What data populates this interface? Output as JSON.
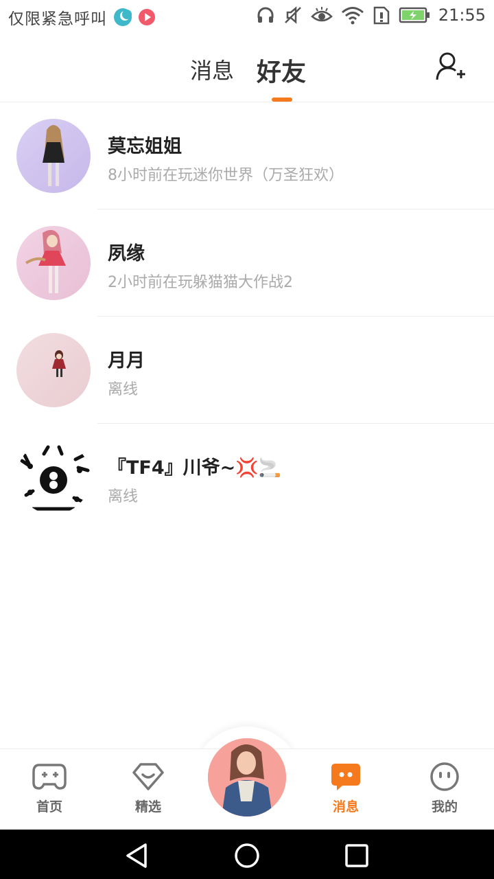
{
  "status_bar": {
    "carrier": "仅限紧急呼叫",
    "time": "21:55",
    "icons": [
      "moon-icon",
      "record-icon",
      "headphones-icon",
      "mute-icon",
      "eye-icon",
      "wifi-icon",
      "sim-icon",
      "battery-icon"
    ]
  },
  "header": {
    "tabs": [
      {
        "label": "消息",
        "active": false
      },
      {
        "label": "好友",
        "active": true
      }
    ],
    "accent_color": "#f57a1e",
    "add_friend_icon": "add-person-icon"
  },
  "friends": [
    {
      "name": "莫忘姐姐",
      "status": "8小时前在玩迷你世界（万圣狂欢）"
    },
    {
      "name": "夙缘",
      "status": "2小时前在玩躲猫猫大作战2"
    },
    {
      "name": "月月",
      "status": "离线"
    },
    {
      "name": "『TF4』川爷~💢🚬",
      "status": "离线"
    }
  ],
  "bottom_nav": {
    "items": [
      {
        "label": "首页",
        "icon": "gamepad-icon",
        "active": false
      },
      {
        "label": "精选",
        "icon": "heart-badge-icon",
        "active": false
      },
      {
        "label": "消息",
        "icon": "chat-icon",
        "active": true
      },
      {
        "label": "我的",
        "icon": "face-icon",
        "active": false
      }
    ]
  }
}
